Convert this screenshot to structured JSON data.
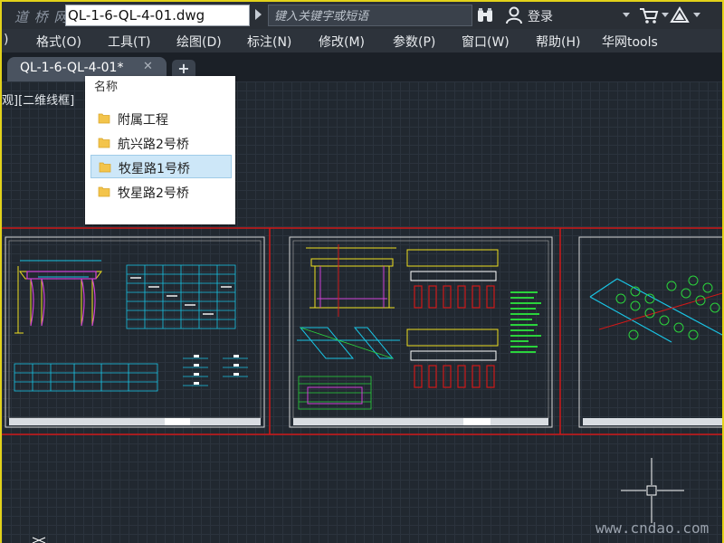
{
  "title_bar": {
    "logo_text": "道 桥 网",
    "filename": "QL-1-6-QL-4-01.dwg",
    "search_placeholder": "键入关键字或短语",
    "login_label": "登录"
  },
  "menu": {
    "items": [
      ")",
      "格式(O)",
      "工具(T)",
      "绘图(D)",
      "标注(N)",
      "修改(M)",
      "参数(P)",
      "窗口(W)",
      "帮助(H)",
      "华网tools"
    ]
  },
  "tabs": {
    "active_label": "QL-1-6-QL-4-01*",
    "close_glyph": "✕",
    "new_tab_glyph": "+"
  },
  "viewport": {
    "label": "观][二维线框]"
  },
  "folder_dropdown": {
    "header": "名称",
    "items": [
      "附属工程",
      "航兴路2号桥",
      "牧星路1号桥",
      "牧星路2号桥"
    ],
    "selected_index": 2
  },
  "watermark": "www.cndao.com",
  "colors": {
    "cad_background": "#212830",
    "frame_red": "#d01818",
    "cyan": "#19c4e4",
    "yellow": "#f0e020",
    "green": "#2bd33c",
    "magenta": "#d040d8",
    "selection": "#cde7f8"
  }
}
